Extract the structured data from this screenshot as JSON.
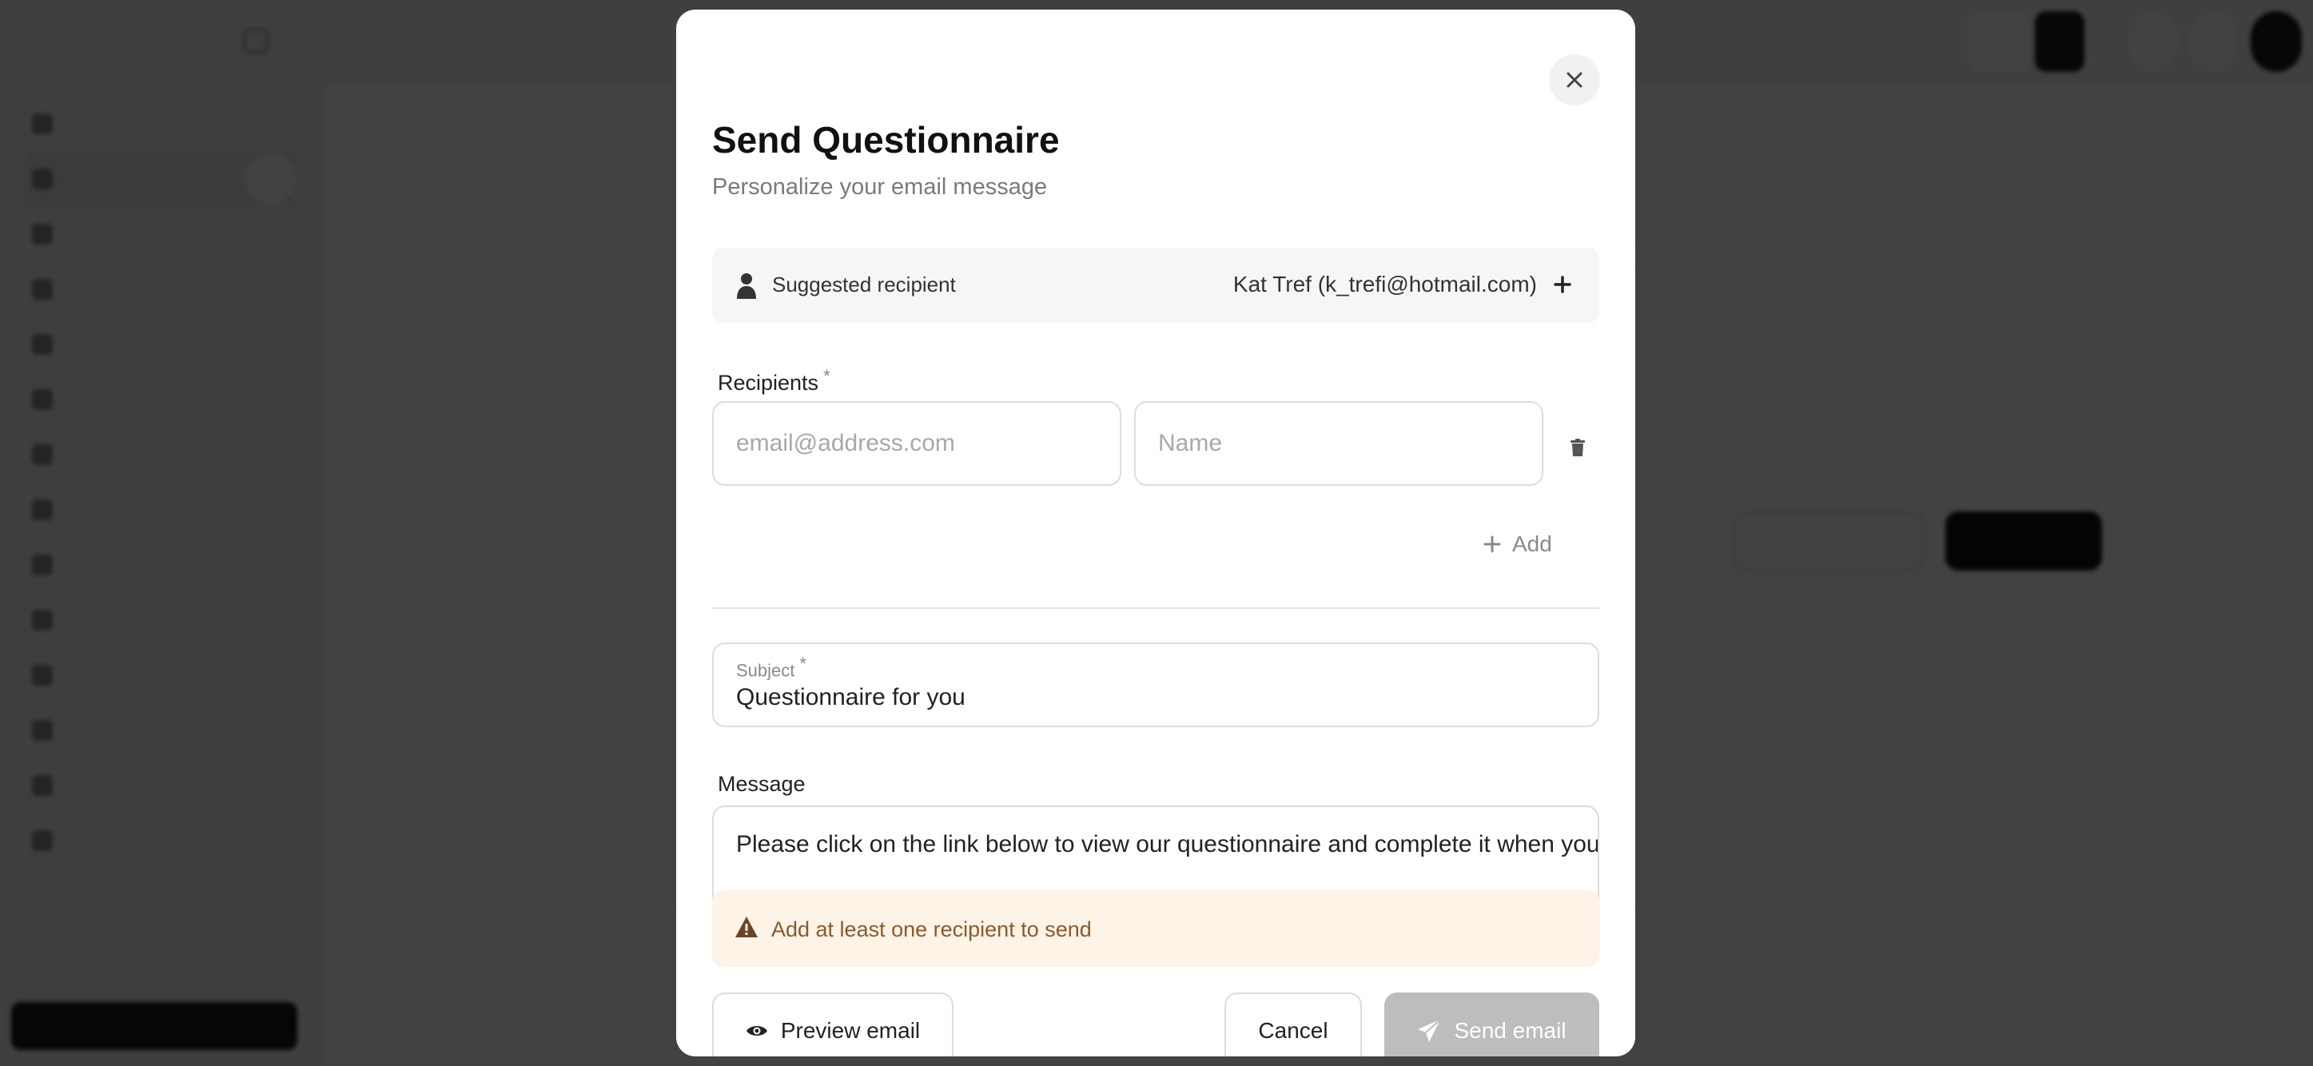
{
  "modal": {
    "title": "Send Questionnaire",
    "subtitle": "Personalize your email message",
    "suggested": {
      "label": "Suggested recipient",
      "recipient": "Kat Tref (k_trefi@hotmail.com)"
    },
    "recipients": {
      "label": "Recipients",
      "required_mark": "*",
      "email_placeholder": "email@address.com",
      "name_placeholder": "Name",
      "add_label": "Add"
    },
    "subject": {
      "label": "Subject",
      "required_mark": "*",
      "value": "Questionnaire for you"
    },
    "message": {
      "label": "Message",
      "value": "Please click on the link below to view our questionnaire and complete it when you"
    },
    "warning": "Add at least one recipient to send",
    "buttons": {
      "preview": "Preview email",
      "cancel": "Cancel",
      "send": "Send email"
    }
  },
  "colors": {
    "overlay": "#000000",
    "warning_bg": "#fdf3e6",
    "warning_text": "#8a5a2e",
    "send_disabled": "#bdbdbd"
  },
  "icons": {
    "close": "close-icon",
    "person": "person-icon",
    "plus": "plus-icon",
    "trash": "trash-icon",
    "warning": "warning-icon",
    "eye": "eye-icon",
    "send": "send-icon"
  }
}
